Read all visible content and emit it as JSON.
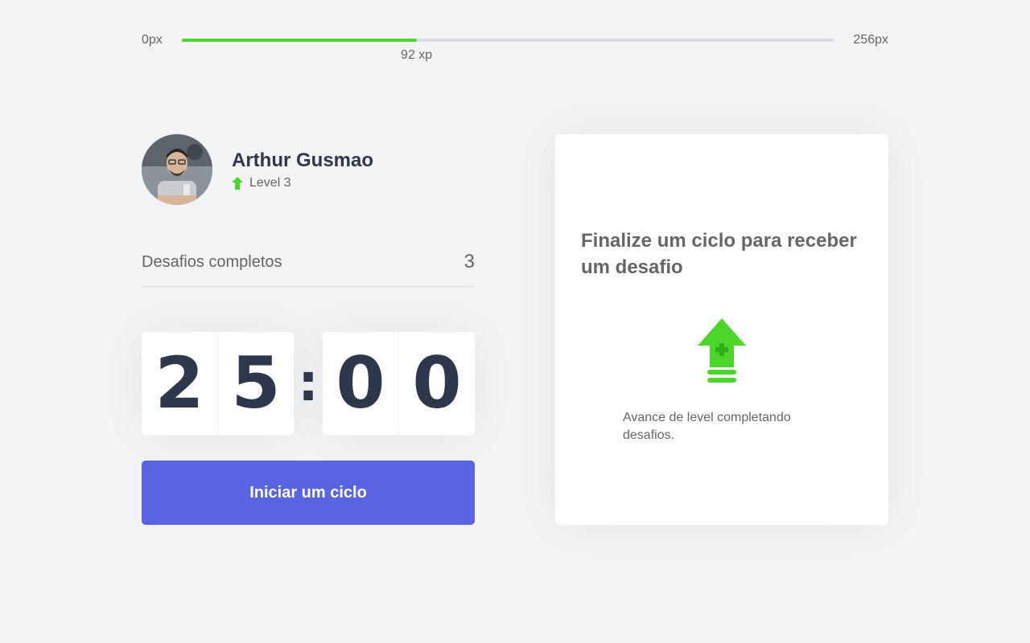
{
  "xp_bar": {
    "min_label": "0px",
    "max_label": "256px",
    "current_label": "92 xp",
    "progress_fraction": 0.36,
    "fill_color": "#4cd62b"
  },
  "profile": {
    "name": "Arthur Gusmao",
    "level_label": "Level 3",
    "level_icon": "level-up-arrow-icon"
  },
  "challenges": {
    "label": "Desafios completos",
    "count": "3"
  },
  "countdown": {
    "minute_left": "2",
    "minute_right": "5",
    "separator": ":",
    "second_left": "0",
    "second_right": "0"
  },
  "start_button": {
    "label": "Iniciar um ciclo",
    "color": "#5965e0"
  },
  "challenge_card": {
    "title": "Finalize um ciclo para receber um desafio",
    "icon": "level-up-icon",
    "description": "Avance de level completando desafios."
  }
}
